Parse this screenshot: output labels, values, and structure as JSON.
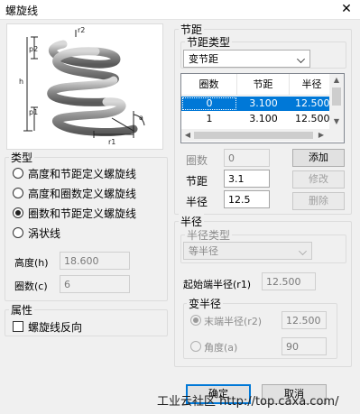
{
  "window": {
    "title": "螺旋线",
    "close_glyph": "✕"
  },
  "preview": {
    "labels": {
      "r2": "r2",
      "p2": "p2",
      "h": "h",
      "p1": "p1",
      "a": "a",
      "r1": "r1"
    }
  },
  "type_group": {
    "legend": "类型",
    "options": [
      {
        "label": "高度和节距定义螺旋线",
        "checked": false
      },
      {
        "label": "高度和圈数定义螺旋线",
        "checked": false
      },
      {
        "label": "圈数和节距定义螺旋线",
        "checked": true
      },
      {
        "label": "涡状线",
        "checked": false
      }
    ],
    "height_label": "高度(h)",
    "height_value": "18.600",
    "turns_label": "圈数(c)",
    "turns_value": "6"
  },
  "attr_group": {
    "legend": "属性",
    "reverse_label": "螺旋线反向",
    "reverse_checked": false
  },
  "pitch_group": {
    "legend": "节距",
    "type_legend": "节距类型",
    "type_value": "变节距",
    "table": {
      "headers": [
        "圈数",
        "节距",
        "半径"
      ],
      "rows": [
        {
          "turns": "0",
          "pitch": "3.100",
          "radius": "12.500",
          "selected": true
        },
        {
          "turns": "1",
          "pitch": "3.100",
          "radius": "12.500",
          "selected": false
        }
      ]
    },
    "turns_label": "圈数",
    "turns_value": "0",
    "pitch_label": "节距",
    "pitch_value": "3.1",
    "radius_label": "半径",
    "radius_value": "12.5",
    "add_label": "添加",
    "modify_label": "修改",
    "delete_label": "删除"
  },
  "radius_group": {
    "legend": "半径",
    "type_legend": "半径类型",
    "type_value": "等半径",
    "start_label": "起始端半径(r1)",
    "start_value": "12.500",
    "var_legend": "变半径",
    "end_label": "末端半径(r2)",
    "end_value": "12.500",
    "angle_label": "角度(a)",
    "angle_value": "90"
  },
  "buttons": {
    "ok": "确定",
    "cancel": "取消"
  },
  "watermark": "工业云社区  http://top.caxa.com/"
}
